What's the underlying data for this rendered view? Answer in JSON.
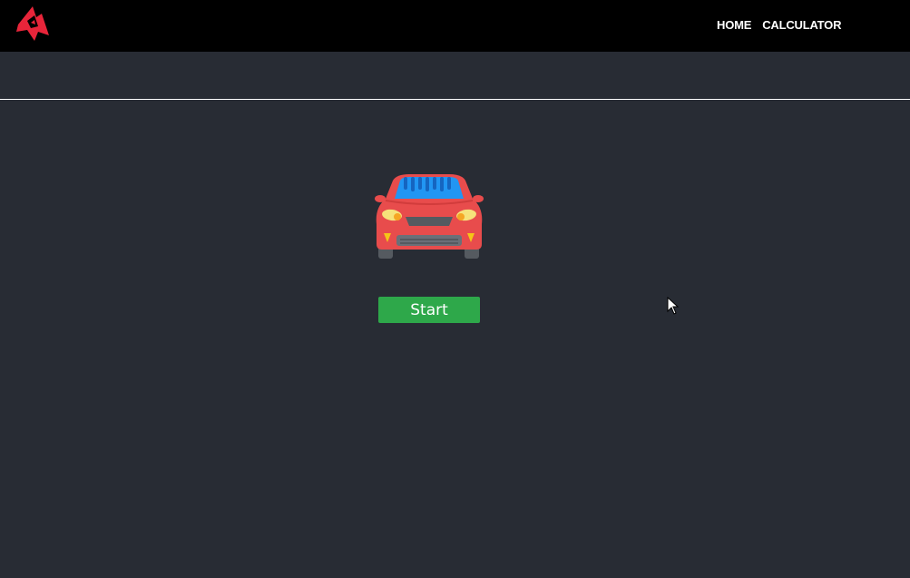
{
  "header": {
    "logo_icon": "brand-logo-icon",
    "nav": [
      {
        "label": "HOME"
      },
      {
        "label": "CALCULATOR"
      }
    ]
  },
  "main": {
    "hero_icon": "red-car-icon",
    "start_label": "Start"
  },
  "colors": {
    "navbar_bg": "#000000",
    "page_bg": "#282c34",
    "brand_red": "#e8253a",
    "button_green": "#2ea84a"
  }
}
